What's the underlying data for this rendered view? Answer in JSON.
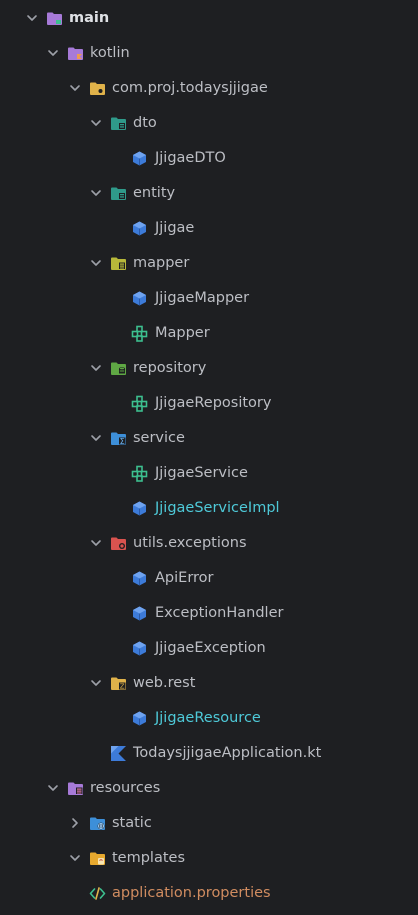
{
  "tree": {
    "main": "main",
    "kotlin": "kotlin",
    "package": "com.proj.todaysjjigae",
    "dto": "dto",
    "jjigae_dto": "JjigaeDTO",
    "entity": "entity",
    "jjigae": "Jjigae",
    "mapper": "mapper",
    "jjigae_mapper": "JjigaeMapper",
    "mapper_iface": "Mapper",
    "repository": "repository",
    "jjigae_repository": "JjigaeRepository",
    "service": "service",
    "jjigae_service": "JjigaeService",
    "jjigae_service_impl": "JjigaeServiceImpl",
    "utils_exceptions": "utils.exceptions",
    "api_error": "ApiError",
    "exception_handler": "ExceptionHandler",
    "jjigae_exception": "JjigaeException",
    "web_rest": "web.rest",
    "jjigae_resource": "JjigaeResource",
    "application_kt": "TodaysjjigaeApplication.kt",
    "resources": "resources",
    "static": "static",
    "templates": "templates",
    "application_properties": "application.properties"
  },
  "colors": {
    "background": "#1e1f22",
    "text": "#bcbec4",
    "class_icon": "#3d7bd9",
    "interface_icon": "#3dbf8f",
    "modified_text": "#56a8f5",
    "properties_text": "#d08c60"
  }
}
